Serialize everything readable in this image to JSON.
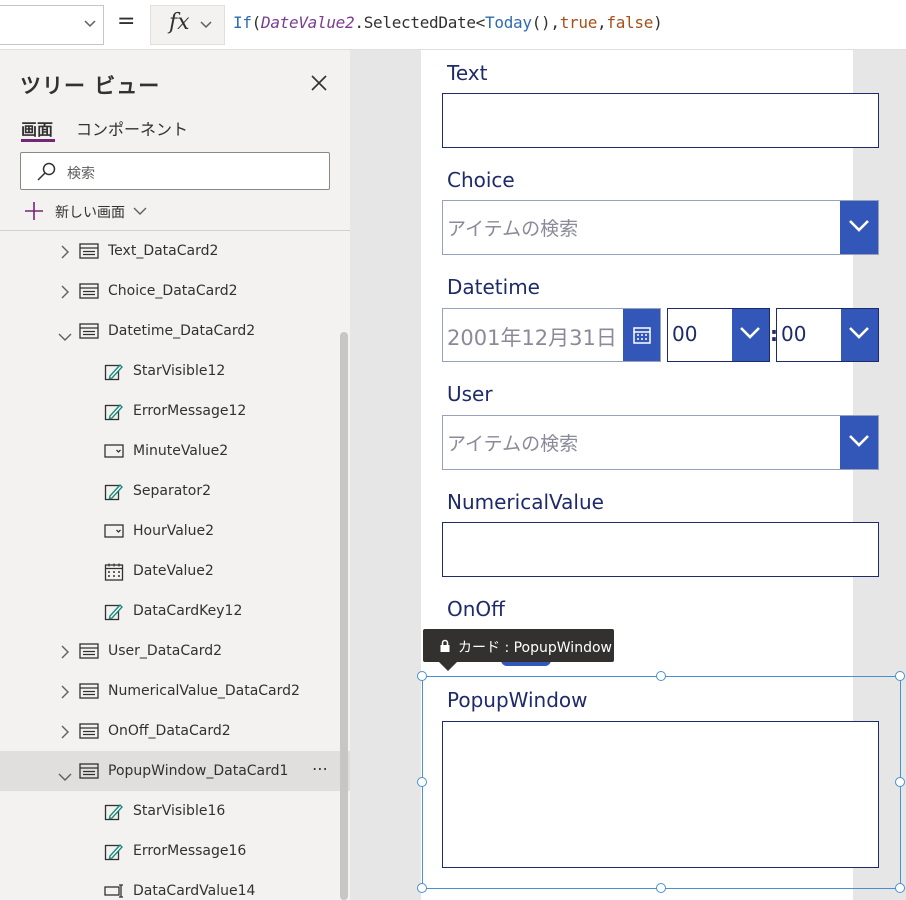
{
  "formula_bar": {
    "equals": "=",
    "fx_label": "fx",
    "formula_tokens": [
      {
        "text": "If",
        "kind": "fn"
      },
      {
        "text": "(",
        "kind": "plain"
      },
      {
        "text": "DateValue2",
        "kind": "id"
      },
      {
        "text": ".SelectedDate<",
        "kind": "plain"
      },
      {
        "text": "Today",
        "kind": "fn"
      },
      {
        "text": "(),",
        "kind": "plain"
      },
      {
        "text": "true",
        "kind": "kw"
      },
      {
        "text": ",",
        "kind": "plain"
      },
      {
        "text": "false",
        "kind": "kw"
      },
      {
        "text": ")",
        "kind": "plain"
      }
    ]
  },
  "tree": {
    "title": "ツリー ビュー",
    "tabs": [
      {
        "label": "画面"
      },
      {
        "label": "コンポーネント"
      }
    ],
    "search_placeholder": "検索",
    "new_screen": "新しい画面",
    "items": [
      {
        "label": "Text_DataCard2",
        "expander": "collapsed",
        "icon": "card-icon",
        "indent": 0
      },
      {
        "label": "Choice_DataCard2",
        "expander": "collapsed",
        "icon": "card-icon",
        "indent": 0
      },
      {
        "label": "Datetime_DataCard2",
        "expander": "expanded",
        "icon": "card-icon",
        "indent": 0
      },
      {
        "label": "StarVisible12",
        "expander": "none",
        "icon": "label-edit-icon",
        "indent": 1
      },
      {
        "label": "ErrorMessage12",
        "expander": "none",
        "icon": "label-edit-icon",
        "indent": 1
      },
      {
        "label": "MinuteValue2",
        "expander": "none",
        "icon": "dropdown-icon",
        "indent": 1
      },
      {
        "label": "Separator2",
        "expander": "none",
        "icon": "label-edit-icon",
        "indent": 1
      },
      {
        "label": "HourValue2",
        "expander": "none",
        "icon": "dropdown-icon",
        "indent": 1
      },
      {
        "label": "DateValue2",
        "expander": "none",
        "icon": "calendar-icon",
        "indent": 1
      },
      {
        "label": "DataCardKey12",
        "expander": "none",
        "icon": "label-edit-icon",
        "indent": 1
      },
      {
        "label": "User_DataCard2",
        "expander": "collapsed",
        "icon": "card-icon",
        "indent": 0
      },
      {
        "label": "NumericalValue_DataCard2",
        "expander": "collapsed",
        "icon": "card-icon",
        "indent": 0
      },
      {
        "label": "OnOff_DataCard2",
        "expander": "collapsed",
        "icon": "card-icon",
        "indent": 0
      },
      {
        "label": "PopupWindow_DataCard1",
        "expander": "expanded",
        "icon": "card-icon",
        "indent": 0,
        "selected": true,
        "more": "⋯"
      },
      {
        "label": "StarVisible16",
        "expander": "none",
        "icon": "label-edit-icon",
        "indent": 1
      },
      {
        "label": "ErrorMessage16",
        "expander": "none",
        "icon": "label-edit-icon",
        "indent": 1
      },
      {
        "label": "DataCardValue14",
        "expander": "none",
        "icon": "text-input-icon",
        "indent": 1
      }
    ]
  },
  "form": {
    "text_label": "Text",
    "choice_label": "Choice",
    "choice_placeholder": "アイテムの検索",
    "datetime_label": "Datetime",
    "date_value": "2001年12月31日",
    "hour_value": "00",
    "minute_value": "00",
    "time_separator": ":",
    "user_label": "User",
    "user_placeholder": "アイテムの検索",
    "numerical_label": "NumericalValue",
    "onoff_label": "OnOff",
    "popup_label": "PopupWindow"
  },
  "tooltip": {
    "text": "カード : PopupWindow",
    "icon": "lock-icon"
  },
  "colors": {
    "accent": "#3257b8",
    "label": "#1f2a6b",
    "selection": "#4a90d0",
    "tab_underline": "#742774"
  }
}
